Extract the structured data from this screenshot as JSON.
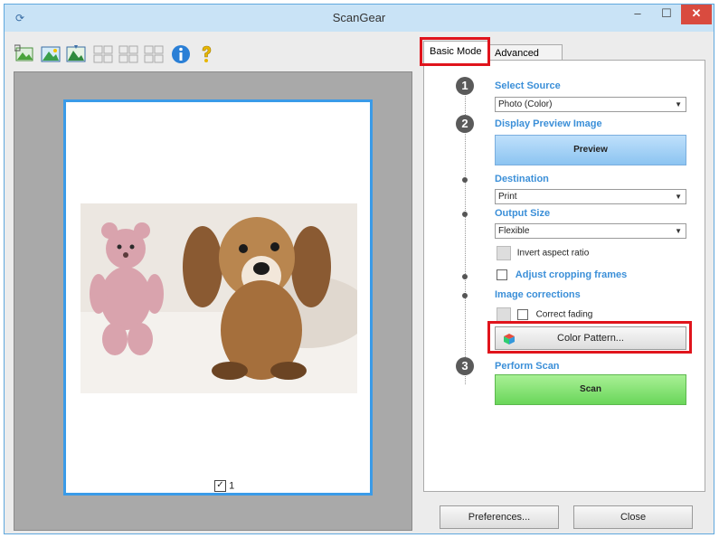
{
  "window": {
    "title": "ScanGear",
    "minimize_glyph": "–",
    "maximize_glyph": "☐",
    "close_glyph": "✕"
  },
  "toolbar": {
    "icons": [
      "scan-crop-icon",
      "image-icon",
      "image-alt-icon",
      "grid-1-icon",
      "grid-2-icon",
      "grid-3-icon",
      "info-icon",
      "help-icon"
    ]
  },
  "preview": {
    "page_checkbox_label": "1",
    "page_checkbox_checked": true
  },
  "tabs": {
    "basic": "Basic Mode",
    "advanced": "Advanced Mode"
  },
  "steps": {
    "s1_number": "1",
    "s1_title": "Select Source",
    "source_value": "Photo (Color)",
    "s2_number": "2",
    "s2_title": "Display Preview Image",
    "preview_button": "Preview",
    "destination_title": "Destination",
    "destination_value": "Print",
    "output_size_title": "Output Size",
    "output_size_value": "Flexible",
    "invert_aspect_label": "Invert aspect ratio",
    "adjust_cropping_label": "Adjust cropping frames",
    "image_corrections_title": "Image corrections",
    "correct_fading_label": "Correct fading",
    "color_pattern_button": "Color Pattern...",
    "s3_number": "3",
    "s3_title": "Perform Scan",
    "scan_button": "Scan"
  },
  "footer": {
    "preferences": "Preferences...",
    "close": "Close"
  },
  "colors": {
    "accent_blue": "#3b8fd8",
    "highlight_red": "#e0141c",
    "scan_green": "#6ad65a",
    "preview_blue": "#8cc4f1"
  }
}
